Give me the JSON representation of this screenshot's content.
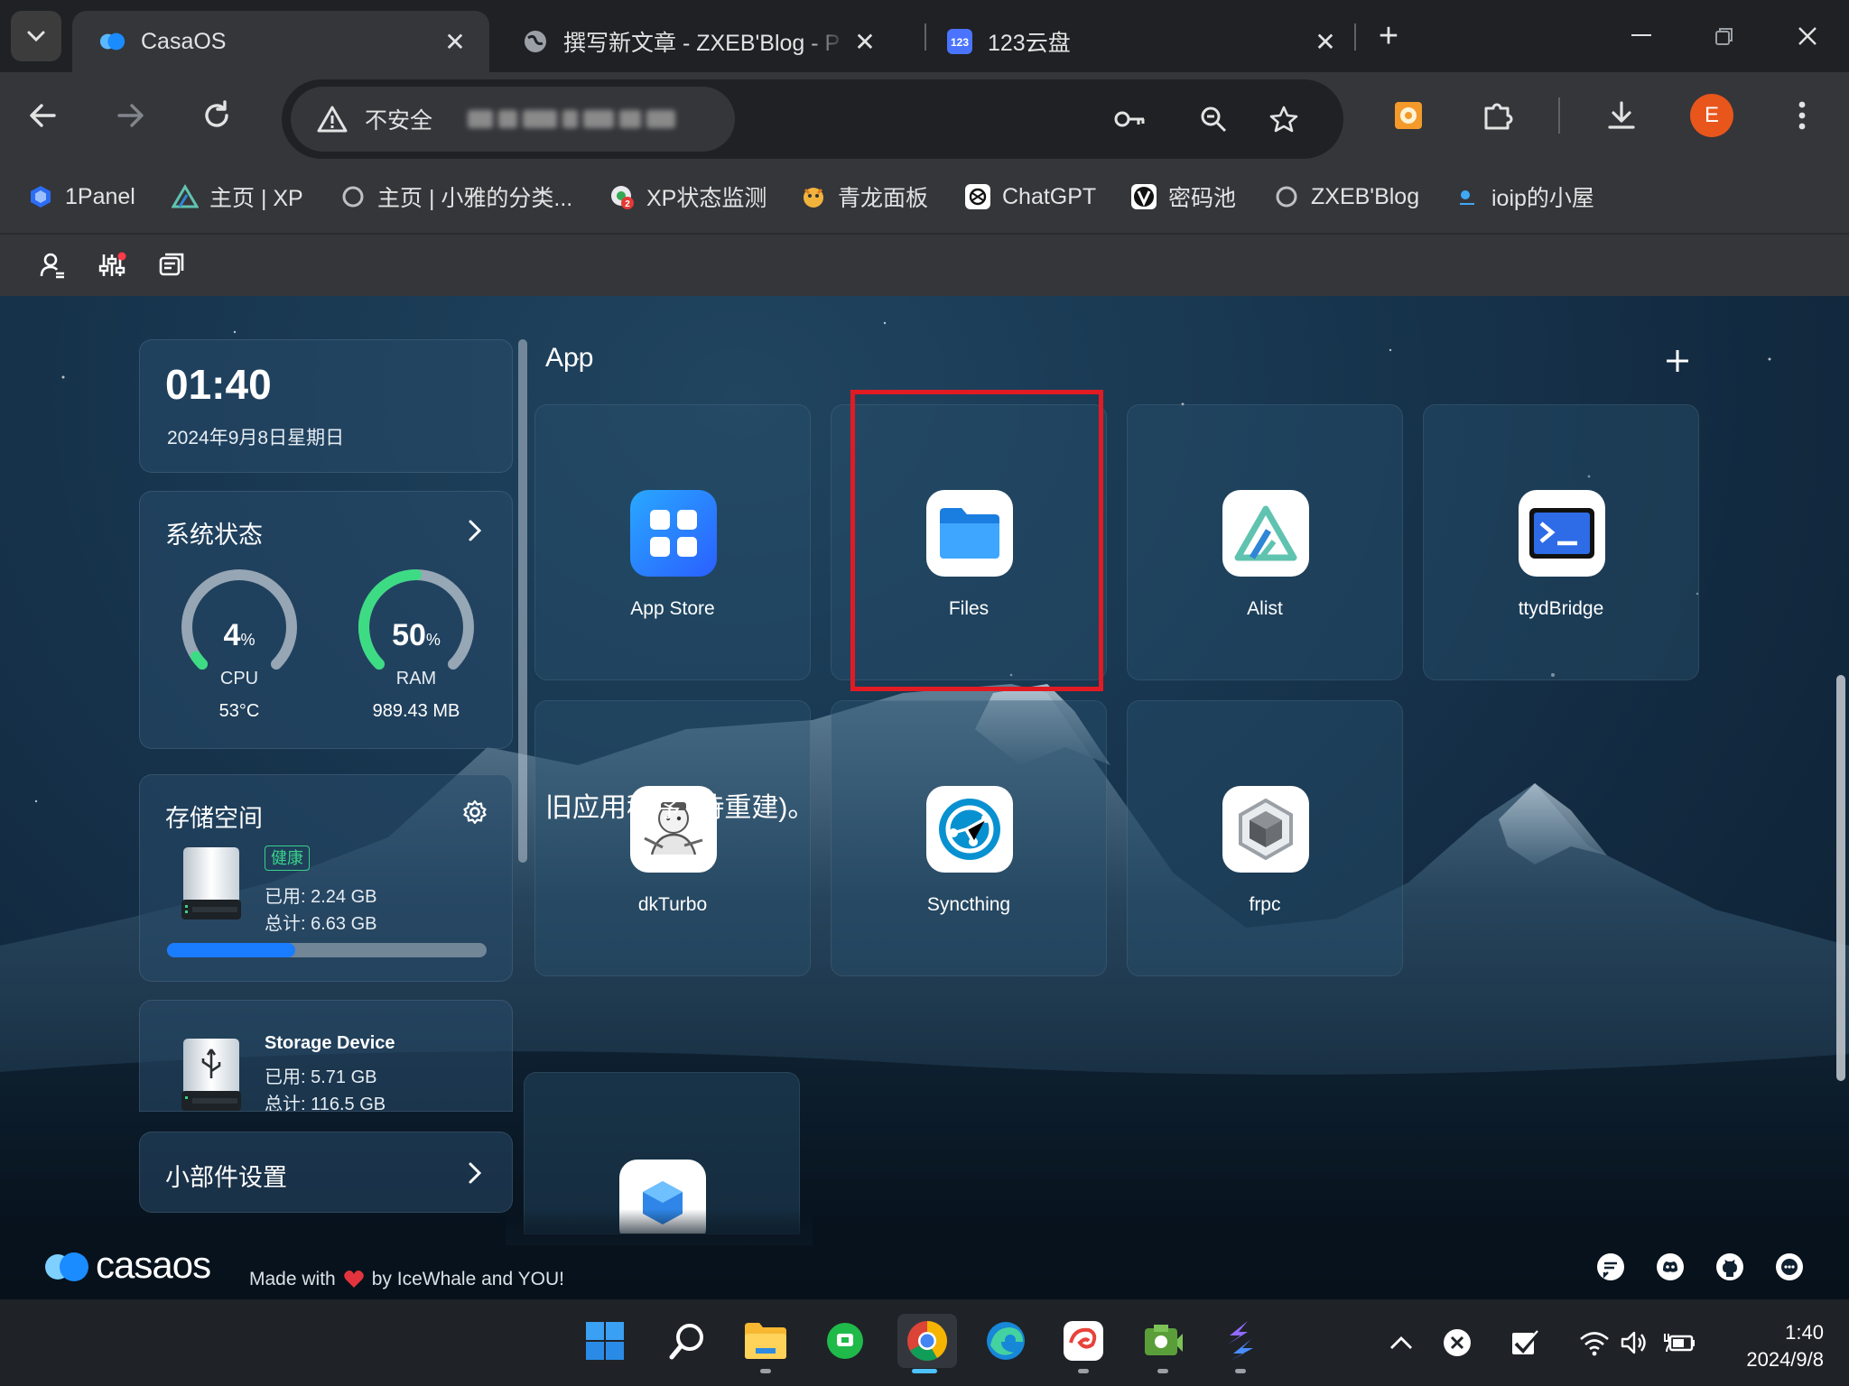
{
  "browser": {
    "tabs": [
      {
        "title": "CasaOS",
        "active": true
      },
      {
        "title": "撰写新文章 - ZXEB'Blog - P",
        "active": false
      },
      {
        "title": "123云盘",
        "active": false
      }
    ],
    "security_label": "不安全",
    "profile_initial": "E"
  },
  "bookmarks": [
    {
      "label": "1Panel",
      "icon": "1panel-icon"
    },
    {
      "label": "主页 | XP",
      "icon": "xp-icon"
    },
    {
      "label": "主页 | 小雅的分类...",
      "icon": "xiaoya-icon"
    },
    {
      "label": "XP状态监测",
      "icon": "monitor-icon"
    },
    {
      "label": "青龙面板",
      "icon": "qinglong-icon"
    },
    {
      "label": "ChatGPT",
      "icon": "chatgpt-icon"
    },
    {
      "label": "密码池",
      "icon": "vault-icon"
    },
    {
      "label": "ZXEB'Blog",
      "icon": "blog-icon"
    },
    {
      "label": "ioip的小屋",
      "icon": "ioip-icon"
    }
  ],
  "clock": {
    "time": "01:40",
    "date": "2024年9月8日星期日"
  },
  "system_status": {
    "title": "系统状态",
    "cpu": {
      "percent": "4",
      "unit": "%",
      "label": "CPU",
      "extra": "53°C",
      "fraction": 0.04
    },
    "ram": {
      "percent": "50",
      "unit": "%",
      "label": "RAM",
      "extra": "989.43 MB",
      "fraction": 0.5
    }
  },
  "storage": {
    "title": "存储空间",
    "badge": "健康",
    "used": "已用: 2.24 GB",
    "total": "总计: 6.63 GB",
    "used_fraction": 0.4
  },
  "storage_device": {
    "title": "Storage Device",
    "used": "已用: 5.71 GB",
    "total": "总计: 116.5 GB"
  },
  "widget_settings": {
    "title": "小部件设置"
  },
  "apps_section": {
    "title": "App"
  },
  "apps": [
    {
      "name": "App Store",
      "icon": "appstore-icon"
    },
    {
      "name": "Files",
      "icon": "folder-icon"
    },
    {
      "name": "Alist",
      "icon": "alist-icon"
    },
    {
      "name": "ttydBridge",
      "icon": "terminal-icon"
    },
    {
      "name": "dkTurbo",
      "icon": "dkturbo-icon"
    },
    {
      "name": "Syncthing",
      "icon": "syncthing-icon"
    },
    {
      "name": "frpc",
      "icon": "cube-icon"
    }
  ],
  "legacy_section": {
    "title": "旧应用程序 (待重建)。"
  },
  "footer": {
    "logo_text": "casaos",
    "made_with": "Made with",
    "by": "by IceWhale and YOU!"
  },
  "taskbar": {
    "time": "1:40",
    "date": "2024/9/8"
  },
  "colors": {
    "accent_blue": "#1a7cff",
    "healthy_green": "#3ad18a",
    "highlight_red": "#e21b23",
    "gauge_green": "#3ddc84"
  }
}
